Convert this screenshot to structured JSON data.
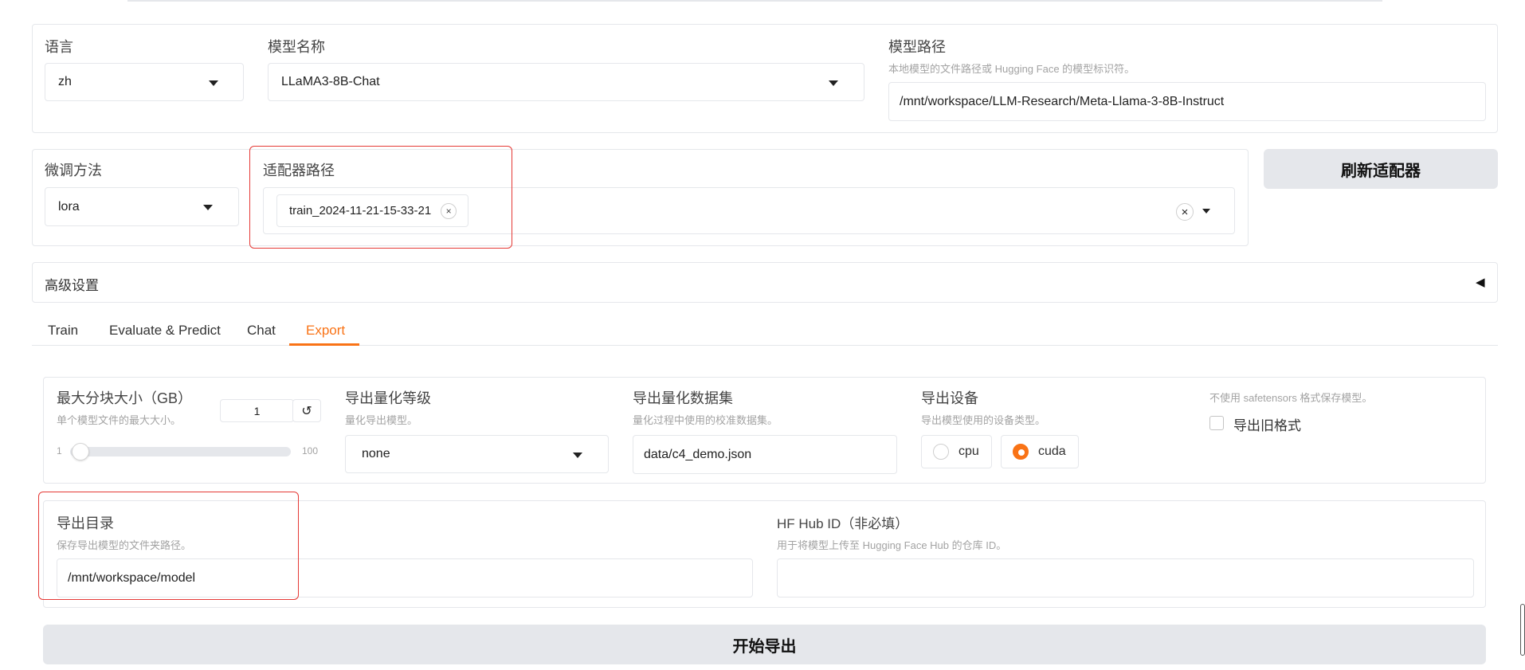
{
  "top": {
    "language": {
      "label": "语言",
      "value": "zh"
    },
    "model_name": {
      "label": "模型名称",
      "value": "LLaMA3-8B-Chat"
    },
    "model_path": {
      "label": "模型路径",
      "hint": "本地模型的文件路径或 Hugging Face 的模型标识符。",
      "value": "/mnt/workspace/LLM-Research/Meta-Llama-3-8B-Instruct"
    }
  },
  "adapter": {
    "finetune_label": "微调方法",
    "finetune_value": "lora",
    "path_label": "适配器路径",
    "chip": "train_2024-11-21-15-33-21",
    "chip_close": "×",
    "clear": "×",
    "refresh_button": "刷新适配器"
  },
  "advanced": {
    "title": "高级设置",
    "toggle": "◀"
  },
  "tabs": [
    {
      "label": "Train"
    },
    {
      "label": "Evaluate & Predict"
    },
    {
      "label": "Chat"
    },
    {
      "label": "Export",
      "active": true
    }
  ],
  "export": {
    "max_shard": {
      "label": "最大分块大小（GB）",
      "hint": "单个模型文件的最大大小。",
      "value": "1",
      "reset": "↺",
      "min": "1",
      "max": "100",
      "fraction": 0.0
    },
    "quant_bit": {
      "label": "导出量化等级",
      "hint": "量化导出模型。",
      "value": "none"
    },
    "quant_dataset": {
      "label": "导出量化数据集",
      "hint": "量化过程中使用的校准数据集。",
      "value": "data/c4_demo.json"
    },
    "device": {
      "label": "导出设备",
      "hint": "导出模型使用的设备类型。",
      "options": [
        "cpu",
        "cuda"
      ],
      "selected": "cuda"
    },
    "legacy": {
      "hint": "不使用 safetensors 格式保存模型。",
      "label": "导出旧格式",
      "checked": false
    },
    "export_dir": {
      "label": "导出目录",
      "hint": "保存导出模型的文件夹路径。",
      "value": "/mnt/workspace/model"
    },
    "hub_id": {
      "label": "HF Hub ID（非必填）",
      "hint": "用于将模型上传至 Hugging Face Hub 的仓库 ID。",
      "value": ""
    },
    "start_button": "开始导出"
  },
  "colors": {
    "accent": "#f97316",
    "highlight_box": "#e53935",
    "button_bg": "#e5e7eb"
  }
}
